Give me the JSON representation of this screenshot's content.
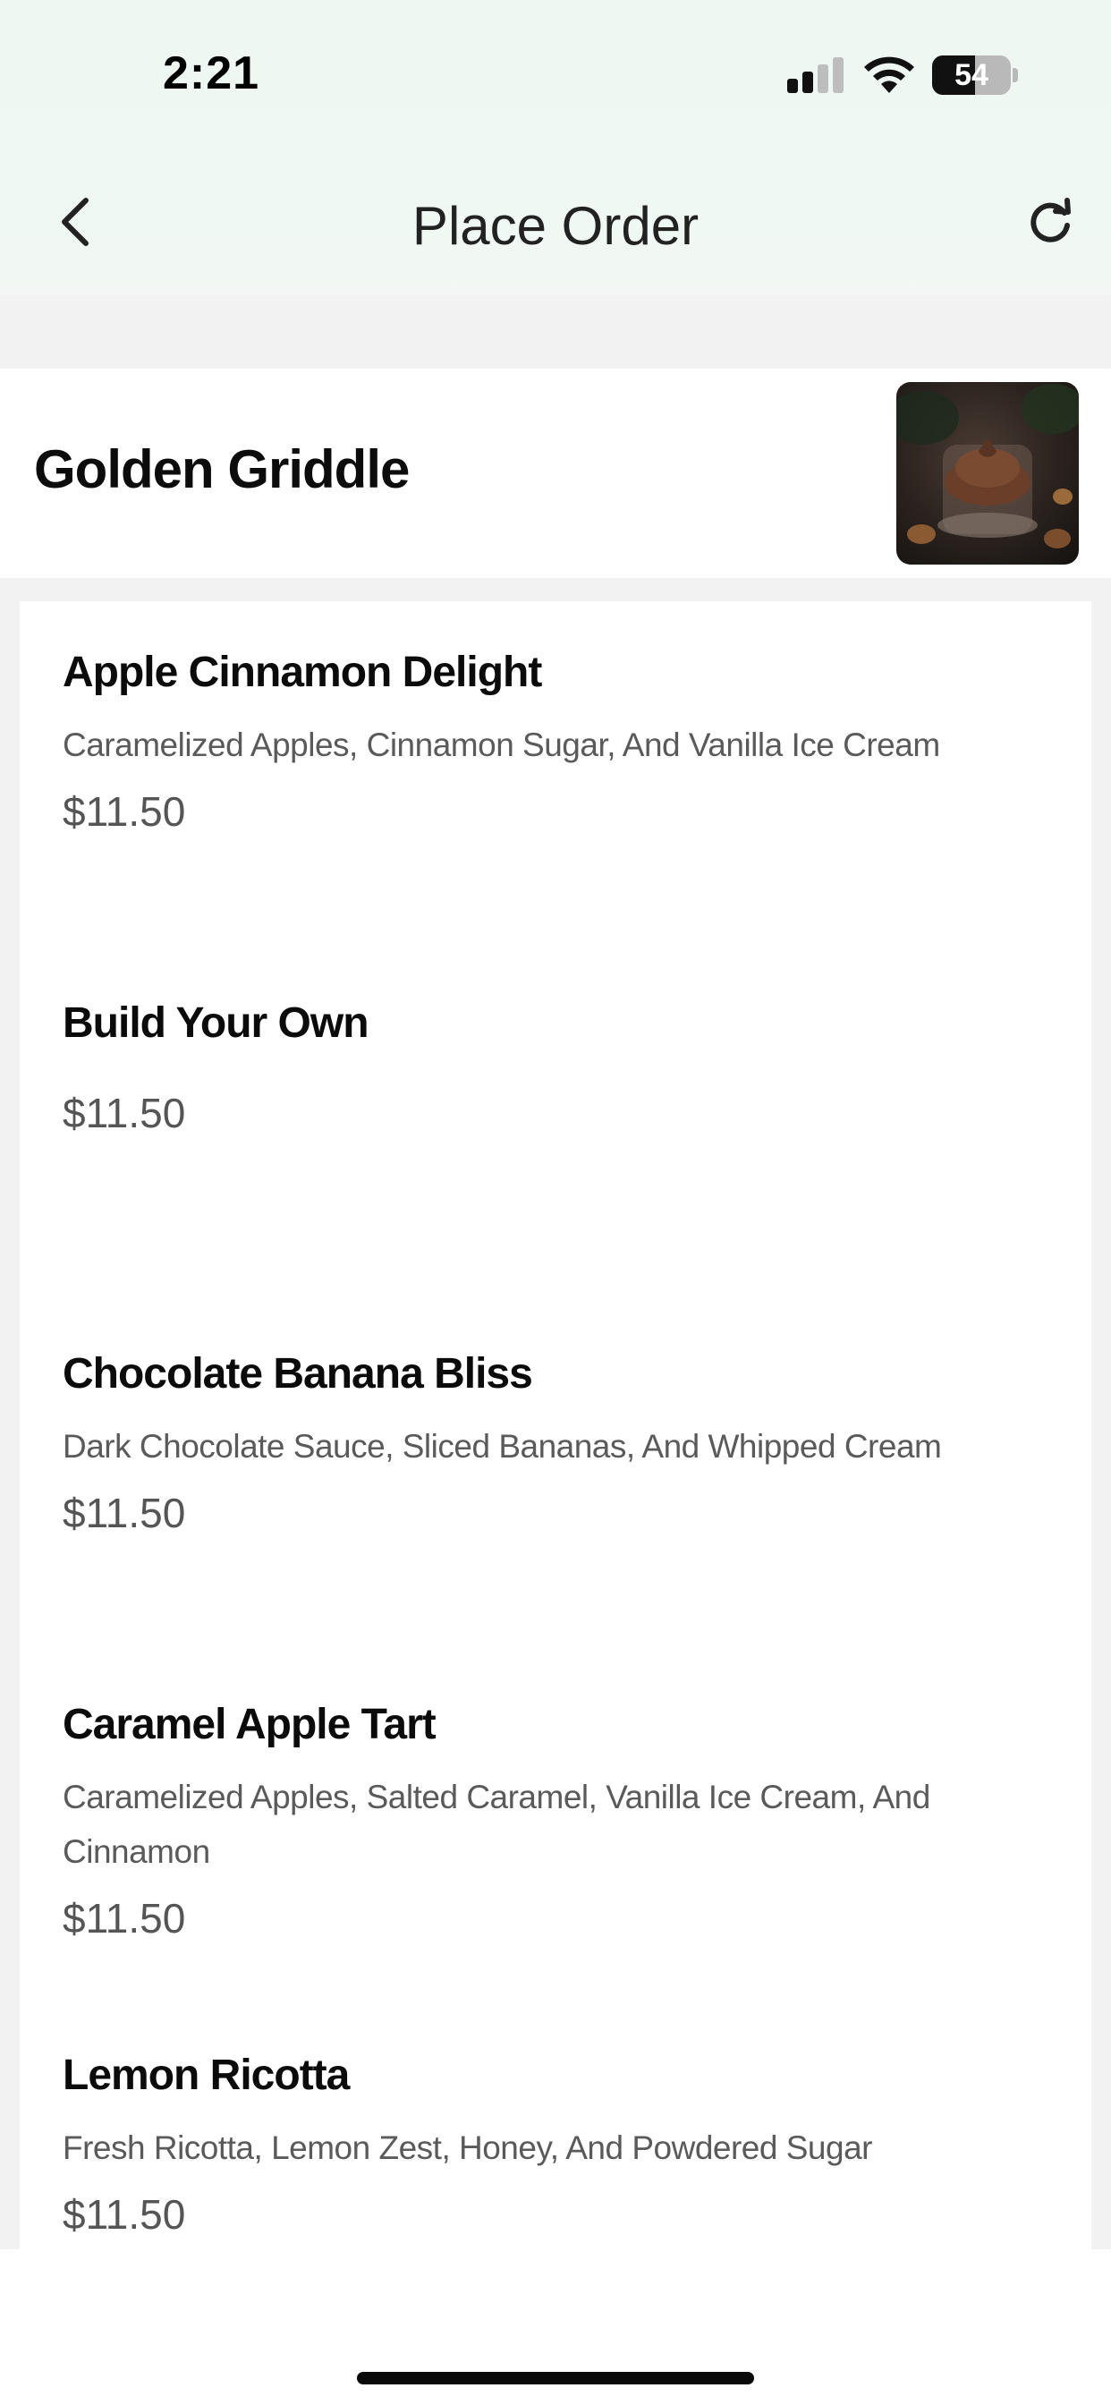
{
  "status_bar": {
    "time": "2:21",
    "battery_level": "54",
    "battery_fraction": 0.54
  },
  "header": {
    "title": "Place Order",
    "back_icon": "chevron-left-icon",
    "refresh_icon": "refresh-icon"
  },
  "restaurant": {
    "name": "Golden Griddle",
    "image": "chocolate-dessert-photo"
  },
  "menu": {
    "items": [
      {
        "name": "Apple Cinnamon Delight",
        "description": "Caramelized Apples, Cinnamon Sugar, And Vanilla Ice Cream",
        "price": "$11.50"
      },
      {
        "name": "Build Your Own",
        "description": "",
        "price": "$11.50"
      },
      {
        "name": "Chocolate Banana Bliss",
        "description": "Dark Chocolate Sauce, Sliced Bananas, And Whipped Cream",
        "price": "$11.50"
      },
      {
        "name": "Caramel Apple Tart",
        "description": "Caramelized Apples, Salted Caramel, Vanilla Ice Cream, And Cinnamon",
        "price": "$11.50"
      },
      {
        "name": "Lemon Ricotta",
        "description": "Fresh Ricotta, Lemon Zest, Honey, And Powdered Sugar",
        "price": "$11.50"
      }
    ]
  },
  "colors": {
    "header_bg": "#eef7f2",
    "page_bg": "#f2f2f2",
    "card_bg": "#ffffff",
    "text_primary": "#0b0b0b",
    "text_secondary": "#5a5a5a"
  }
}
